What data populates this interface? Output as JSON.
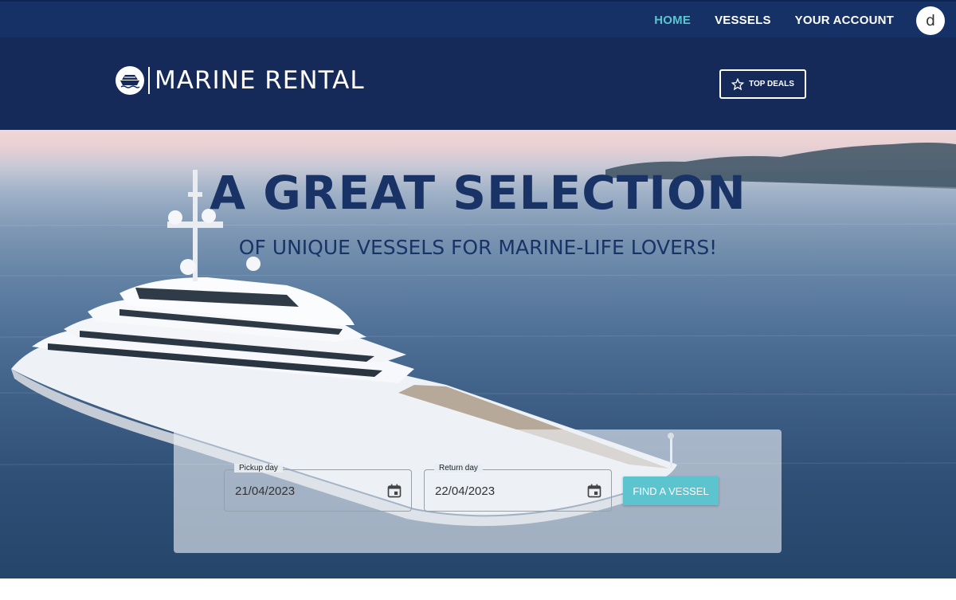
{
  "nav": {
    "items": [
      {
        "label": "HOME",
        "active": true
      },
      {
        "label": "VESSELS",
        "active": false
      },
      {
        "label": "YOUR ACCOUNT",
        "active": false
      }
    ],
    "avatar_initial": "d"
  },
  "brand": {
    "name": "MARINE RENTAL",
    "logo_icon": "ship-icon"
  },
  "top_deals": {
    "label": "TOP DEALS",
    "icon": "star-icon"
  },
  "hero": {
    "headline": "A GREAT SELECTION",
    "subheadline": "OF UNIQUE VESSELS FOR MARINE-LIFE LOVERS!"
  },
  "search": {
    "pickup": {
      "label": "Pickup day",
      "value": "21/04/2023",
      "icon": "calendar-icon"
    },
    "return": {
      "label": "Return day",
      "value": "22/04/2023",
      "icon": "calendar-icon"
    },
    "button_label": "FIND A VESSEL"
  },
  "colors": {
    "nav_bg": "#163166",
    "brand_bg": "#162a5a",
    "accent": "#5bc4cf",
    "headline": "#1a3366"
  }
}
